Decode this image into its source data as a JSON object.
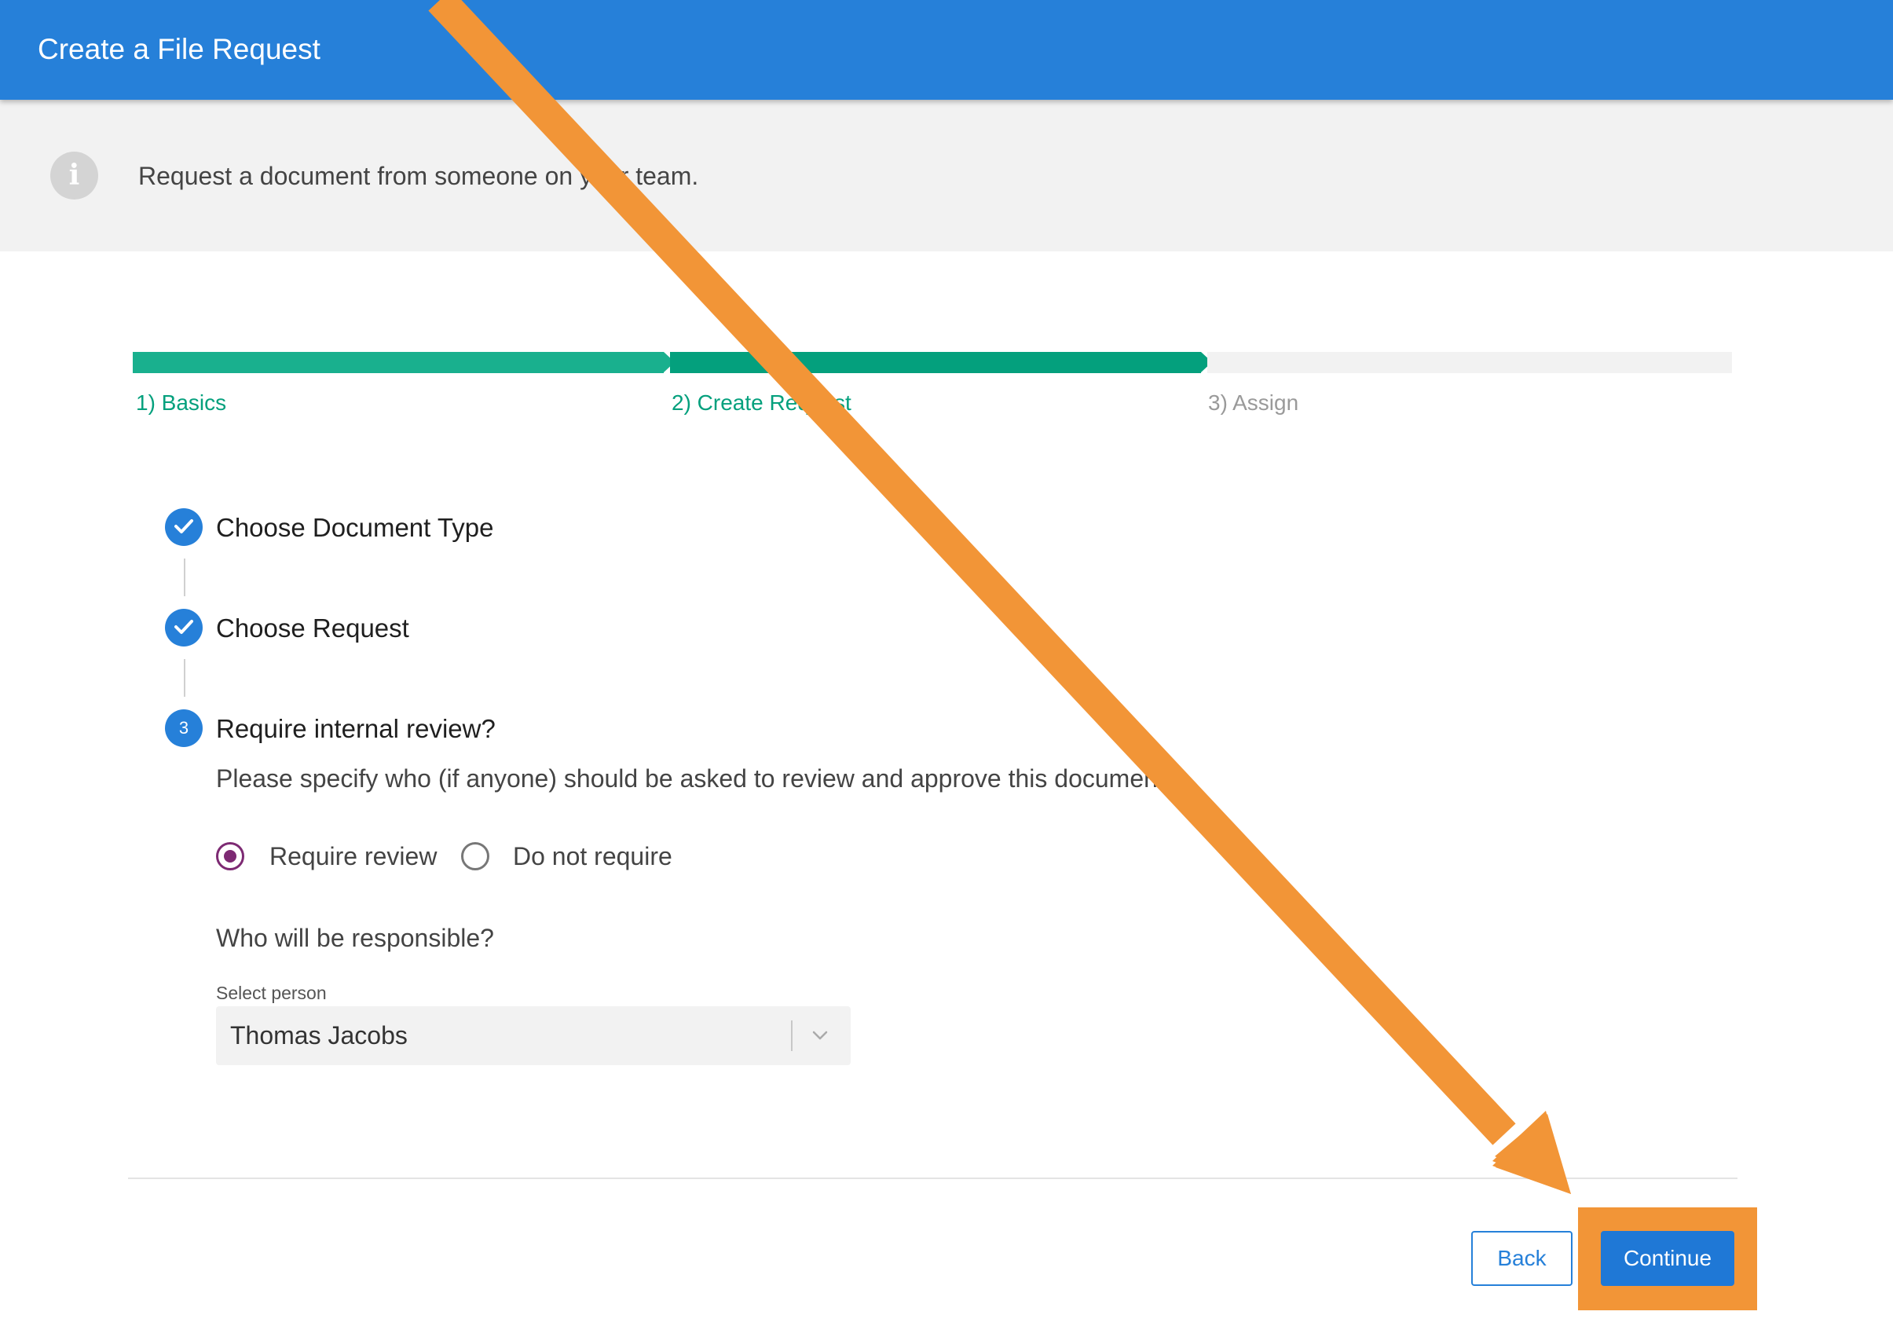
{
  "header": {
    "title": "Create a File Request"
  },
  "info": {
    "icon": "info-icon",
    "text": "Request a document from someone on your team."
  },
  "stepper": {
    "steps": [
      {
        "label": "1) Basics",
        "state": "complete"
      },
      {
        "label": "2) Create Request",
        "state": "active"
      },
      {
        "label": "3) Assign",
        "state": "upcoming"
      }
    ],
    "colors": {
      "complete": "#19b08e",
      "active": "#04a07d",
      "upcoming": "#f2f2f2"
    }
  },
  "checklist": {
    "items": [
      {
        "title": "Choose Document Type",
        "status": "done"
      },
      {
        "title": "Choose Request",
        "status": "done"
      },
      {
        "title": "Require internal review?",
        "status": "current",
        "number": "3"
      }
    ],
    "description": "Please specify who (if anyone) should be asked to review and approve this document."
  },
  "review": {
    "options": [
      {
        "label": "Require review",
        "selected": true
      },
      {
        "label": "Do not require",
        "selected": false
      }
    ],
    "question": "Who will be responsible?",
    "select": {
      "label": "Select person",
      "value": "Thomas Jacobs"
    }
  },
  "footer": {
    "back_label": "Back",
    "continue_label": "Continue"
  },
  "annotation": {
    "color": "#f29537",
    "target": "Continue"
  }
}
